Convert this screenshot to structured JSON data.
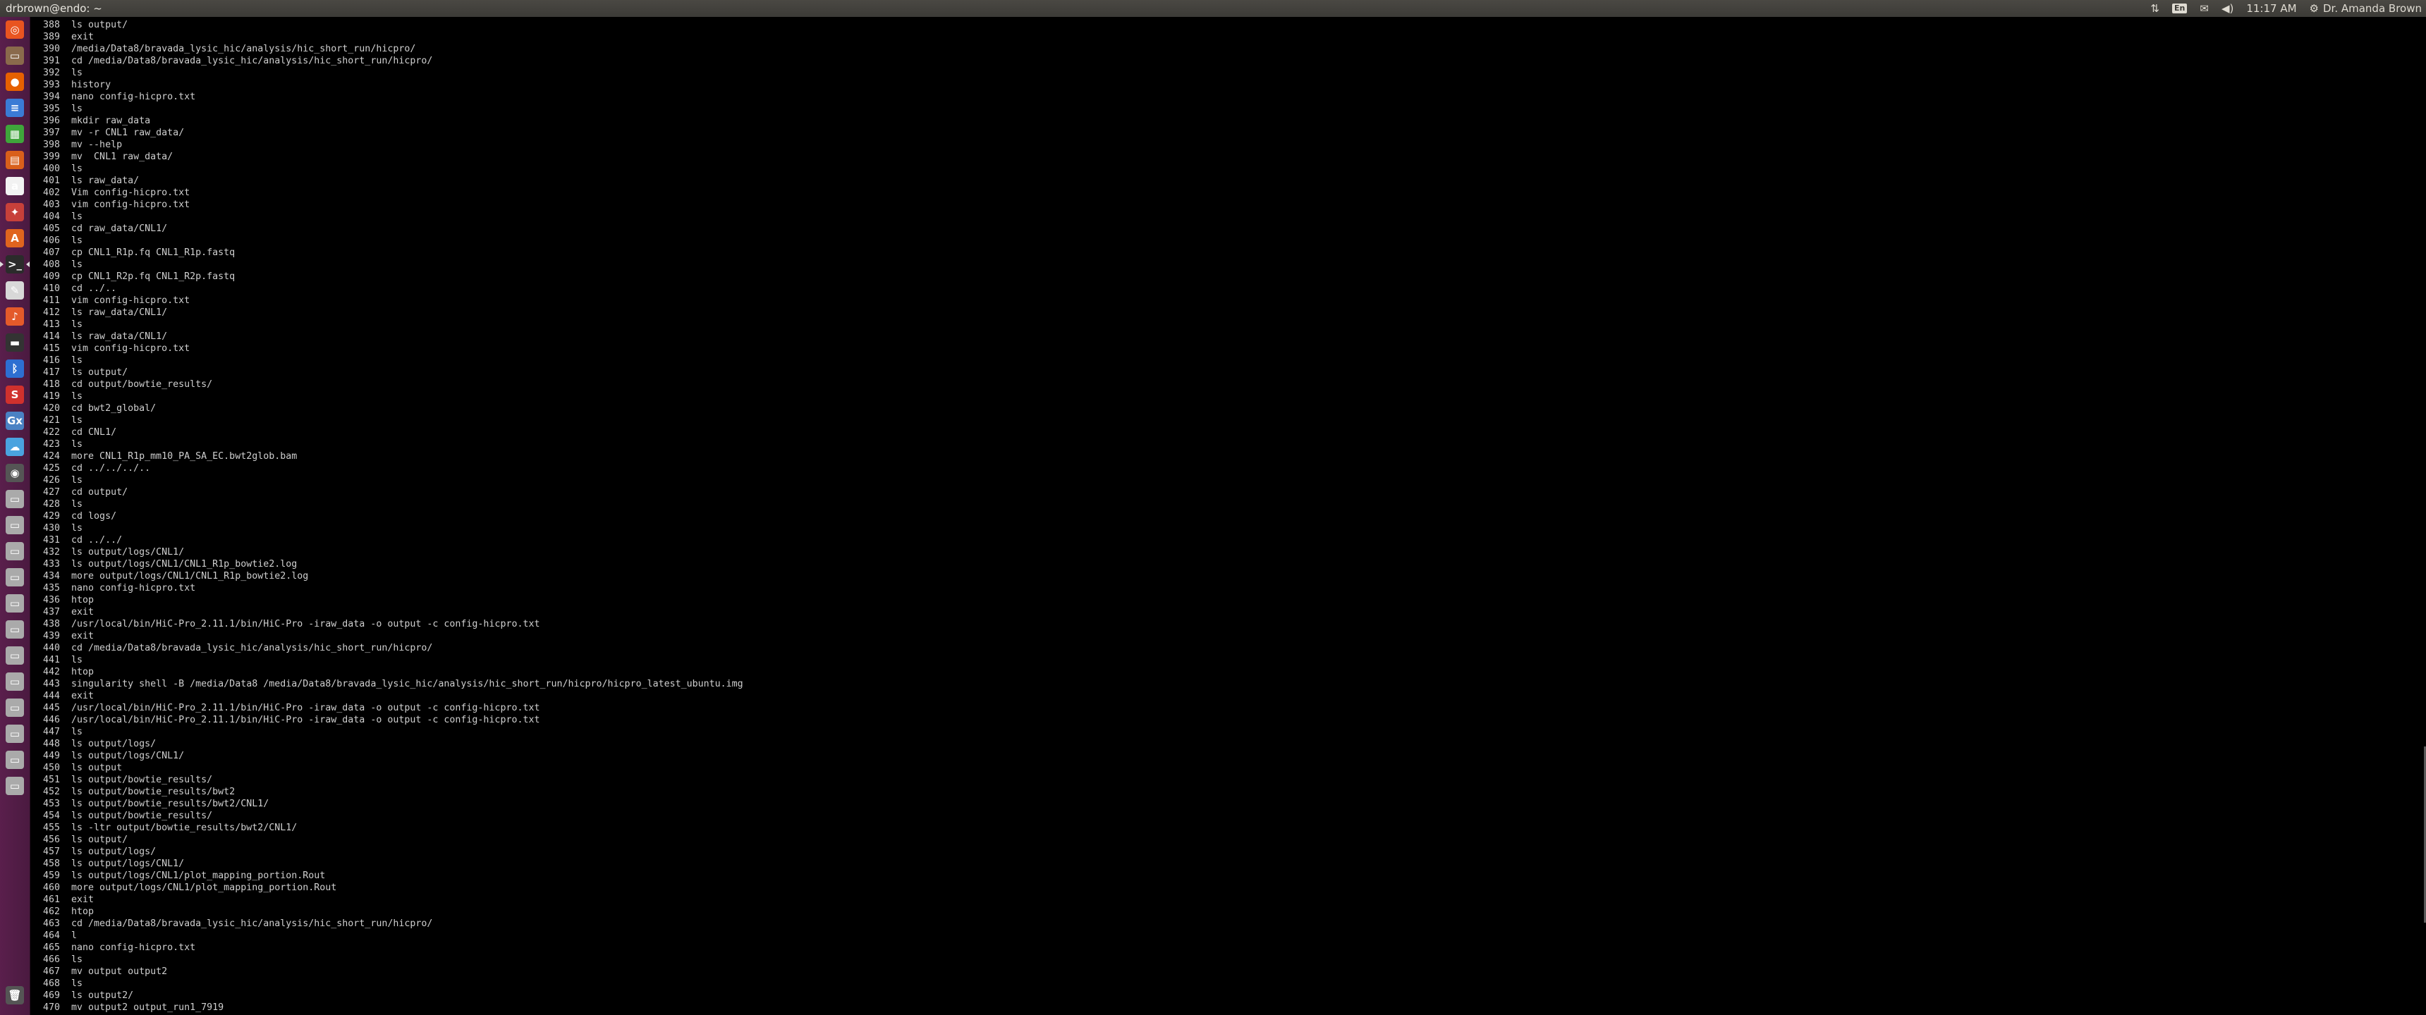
{
  "window": {
    "title": "drbrown@endo: ~"
  },
  "indicators": {
    "network": "⇅",
    "keyboard": "En",
    "mail": "✉",
    "volume": "◀)",
    "time": "11:17 AM",
    "user": "Dr. Amanda Brown"
  },
  "launcher": [
    {
      "name": "ubuntu-dash-icon",
      "glyph": "◎",
      "color": "#e95420"
    },
    {
      "name": "files-icon",
      "glyph": "▭",
      "color": "#8a6a4c"
    },
    {
      "name": "firefox-icon",
      "glyph": "●",
      "color": "#e66000"
    },
    {
      "name": "writer-icon",
      "glyph": "≡",
      "color": "#3a7bd5"
    },
    {
      "name": "calc-icon",
      "glyph": "▦",
      "color": "#3fa53b"
    },
    {
      "name": "impress-icon",
      "glyph": "▤",
      "color": "#d95f1b"
    },
    {
      "name": "amazon-icon",
      "glyph": "a",
      "color": "#f2f2f2"
    },
    {
      "name": "settings-icon",
      "glyph": "✦",
      "color": "#c7403a"
    },
    {
      "name": "software-icon",
      "glyph": "A",
      "color": "#e0641e"
    },
    {
      "name": "terminal-icon",
      "glyph": ">_",
      "color": "#2b2b2b"
    },
    {
      "name": "text-editor-icon",
      "glyph": "✎",
      "color": "#d8d8d8"
    },
    {
      "name": "rhythmbox-icon",
      "glyph": "♪",
      "color": "#e45a2a"
    },
    {
      "name": "system-monitor-icon",
      "glyph": "▬",
      "color": "#333"
    },
    {
      "name": "bluetooth-icon",
      "glyph": "ᛒ",
      "color": "#2d6fd1"
    },
    {
      "name": "vector-icon",
      "glyph": "S",
      "color": "#d0312d"
    },
    {
      "name": "gimp-icon",
      "glyph": "Gx",
      "color": "#4a82c4"
    },
    {
      "name": "browser-icon",
      "glyph": "☁",
      "color": "#4aa3df"
    },
    {
      "name": "chrome-icon",
      "glyph": "◉",
      "color": "#555"
    },
    {
      "name": "drive-icon-1",
      "glyph": "▭",
      "color": "#aaa"
    },
    {
      "name": "drive-icon-2",
      "glyph": "▭",
      "color": "#aaa"
    },
    {
      "name": "drive-icon-3",
      "glyph": "▭",
      "color": "#aaa"
    },
    {
      "name": "drive-icon-4",
      "glyph": "▭",
      "color": "#aaa"
    },
    {
      "name": "drive-icon-5",
      "glyph": "▭",
      "color": "#aaa"
    },
    {
      "name": "drive-icon-6",
      "glyph": "▭",
      "color": "#aaa"
    },
    {
      "name": "drive-icon-7",
      "glyph": "▭",
      "color": "#aaa"
    },
    {
      "name": "drive-icon-8",
      "glyph": "▭",
      "color": "#aaa"
    },
    {
      "name": "drive-icon-9",
      "glyph": "▭",
      "color": "#aaa"
    },
    {
      "name": "drive-icon-10",
      "glyph": "▭",
      "color": "#aaa"
    },
    {
      "name": "drive-icon-11",
      "glyph": "▭",
      "color": "#aaa"
    },
    {
      "name": "drive-icon-12",
      "glyph": "▭",
      "color": "#aaa"
    },
    {
      "name": "trash-icon",
      "glyph": "🗑",
      "color": "#555"
    }
  ],
  "history": [
    {
      "n": "388",
      "cmd": "ls output/"
    },
    {
      "n": "389",
      "cmd": "exit"
    },
    {
      "n": "390",
      "cmd": "/media/Data8/bravada_lysic_hic/analysis/hic_short_run/hicpro/"
    },
    {
      "n": "391",
      "cmd": "cd /media/Data8/bravada_lysic_hic/analysis/hic_short_run/hicpro/"
    },
    {
      "n": "392",
      "cmd": "ls"
    },
    {
      "n": "393",
      "cmd": "history"
    },
    {
      "n": "394",
      "cmd": "nano config-hicpro.txt"
    },
    {
      "n": "395",
      "cmd": "ls"
    },
    {
      "n": "396",
      "cmd": "mkdir raw_data"
    },
    {
      "n": "397",
      "cmd": "mv -r CNL1 raw_data/"
    },
    {
      "n": "398",
      "cmd": "mv --help"
    },
    {
      "n": "399",
      "cmd": "mv  CNL1 raw_data/"
    },
    {
      "n": "400",
      "cmd": "ls"
    },
    {
      "n": "401",
      "cmd": "ls raw_data/"
    },
    {
      "n": "402",
      "cmd": "Vim config-hicpro.txt"
    },
    {
      "n": "403",
      "cmd": "vim config-hicpro.txt"
    },
    {
      "n": "404",
      "cmd": "ls"
    },
    {
      "n": "405",
      "cmd": "cd raw_data/CNL1/"
    },
    {
      "n": "406",
      "cmd": "ls"
    },
    {
      "n": "407",
      "cmd": "cp CNL1_R1p.fq CNL1_R1p.fastq"
    },
    {
      "n": "408",
      "cmd": "ls"
    },
    {
      "n": "409",
      "cmd": "cp CNL1_R2p.fq CNL1_R2p.fastq"
    },
    {
      "n": "410",
      "cmd": "cd ../.."
    },
    {
      "n": "411",
      "cmd": "vim config-hicpro.txt"
    },
    {
      "n": "412",
      "cmd": "ls raw_data/CNL1/"
    },
    {
      "n": "413",
      "cmd": "ls"
    },
    {
      "n": "414",
      "cmd": "ls raw_data/CNL1/"
    },
    {
      "n": "415",
      "cmd": "vim config-hicpro.txt"
    },
    {
      "n": "416",
      "cmd": "ls"
    },
    {
      "n": "417",
      "cmd": "ls output/"
    },
    {
      "n": "418",
      "cmd": "cd output/bowtie_results/"
    },
    {
      "n": "419",
      "cmd": "ls"
    },
    {
      "n": "420",
      "cmd": "cd bwt2_global/"
    },
    {
      "n": "421",
      "cmd": "ls"
    },
    {
      "n": "422",
      "cmd": "cd CNL1/"
    },
    {
      "n": "423",
      "cmd": "ls"
    },
    {
      "n": "424",
      "cmd": "more CNL1_R1p_mm10_PA_SA_EC.bwt2glob.bam"
    },
    {
      "n": "425",
      "cmd": "cd ../../../.."
    },
    {
      "n": "426",
      "cmd": "ls"
    },
    {
      "n": "427",
      "cmd": "cd output/"
    },
    {
      "n": "428",
      "cmd": "ls"
    },
    {
      "n": "429",
      "cmd": "cd logs/"
    },
    {
      "n": "430",
      "cmd": "ls"
    },
    {
      "n": "431",
      "cmd": "cd ../../"
    },
    {
      "n": "432",
      "cmd": "ls output/logs/CNL1/"
    },
    {
      "n": "433",
      "cmd": "ls output/logs/CNL1/CNL1_R1p_bowtie2.log"
    },
    {
      "n": "434",
      "cmd": "more output/logs/CNL1/CNL1_R1p_bowtie2.log"
    },
    {
      "n": "435",
      "cmd": "nano config-hicpro.txt"
    },
    {
      "n": "436",
      "cmd": "htop"
    },
    {
      "n": "437",
      "cmd": "exit"
    },
    {
      "n": "438",
      "cmd": "/usr/local/bin/HiC-Pro_2.11.1/bin/HiC-Pro -iraw_data -o output -c config-hicpro.txt"
    },
    {
      "n": "439",
      "cmd": "exit"
    },
    {
      "n": "440",
      "cmd": "cd /media/Data8/bravada_lysic_hic/analysis/hic_short_run/hicpro/"
    },
    {
      "n": "441",
      "cmd": "ls"
    },
    {
      "n": "442",
      "cmd": "htop"
    },
    {
      "n": "443",
      "cmd": "singularity shell -B /media/Data8 /media/Data8/bravada_lysic_hic/analysis/hic_short_run/hicpro/hicpro_latest_ubuntu.img"
    },
    {
      "n": "444",
      "cmd": "exit"
    },
    {
      "n": "445",
      "cmd": "/usr/local/bin/HiC-Pro_2.11.1/bin/HiC-Pro -iraw_data -o output -c config-hicpro.txt"
    },
    {
      "n": "446",
      "cmd": "/usr/local/bin/HiC-Pro_2.11.1/bin/HiC-Pro -iraw_data -o output -c config-hicpro.txt"
    },
    {
      "n": "447",
      "cmd": "ls"
    },
    {
      "n": "448",
      "cmd": "ls output/logs/"
    },
    {
      "n": "449",
      "cmd": "ls output/logs/CNL1/"
    },
    {
      "n": "450",
      "cmd": "ls output"
    },
    {
      "n": "451",
      "cmd": "ls output/bowtie_results/"
    },
    {
      "n": "452",
      "cmd": "ls output/bowtie_results/bwt2"
    },
    {
      "n": "453",
      "cmd": "ls output/bowtie_results/bwt2/CNL1/"
    },
    {
      "n": "454",
      "cmd": "ls output/bowtie_results/"
    },
    {
      "n": "455",
      "cmd": "ls -ltr output/bowtie_results/bwt2/CNL1/"
    },
    {
      "n": "456",
      "cmd": "ls output/"
    },
    {
      "n": "457",
      "cmd": "ls output/logs/"
    },
    {
      "n": "458",
      "cmd": "ls output/logs/CNL1/"
    },
    {
      "n": "459",
      "cmd": "ls output/logs/CNL1/plot_mapping_portion.Rout"
    },
    {
      "n": "460",
      "cmd": "more output/logs/CNL1/plot_mapping_portion.Rout"
    },
    {
      "n": "461",
      "cmd": "exit"
    },
    {
      "n": "462",
      "cmd": "htop"
    },
    {
      "n": "463",
      "cmd": "cd /media/Data8/bravada_lysic_hic/analysis/hic_short_run/hicpro/"
    },
    {
      "n": "464",
      "cmd": "l"
    },
    {
      "n": "465",
      "cmd": "nano config-hicpro.txt"
    },
    {
      "n": "466",
      "cmd": "ls"
    },
    {
      "n": "467",
      "cmd": "mv output output2"
    },
    {
      "n": "468",
      "cmd": "ls"
    },
    {
      "n": "469",
      "cmd": "ls output2/"
    },
    {
      "n": "470",
      "cmd": "mv output2 output_run1_7919"
    }
  ]
}
